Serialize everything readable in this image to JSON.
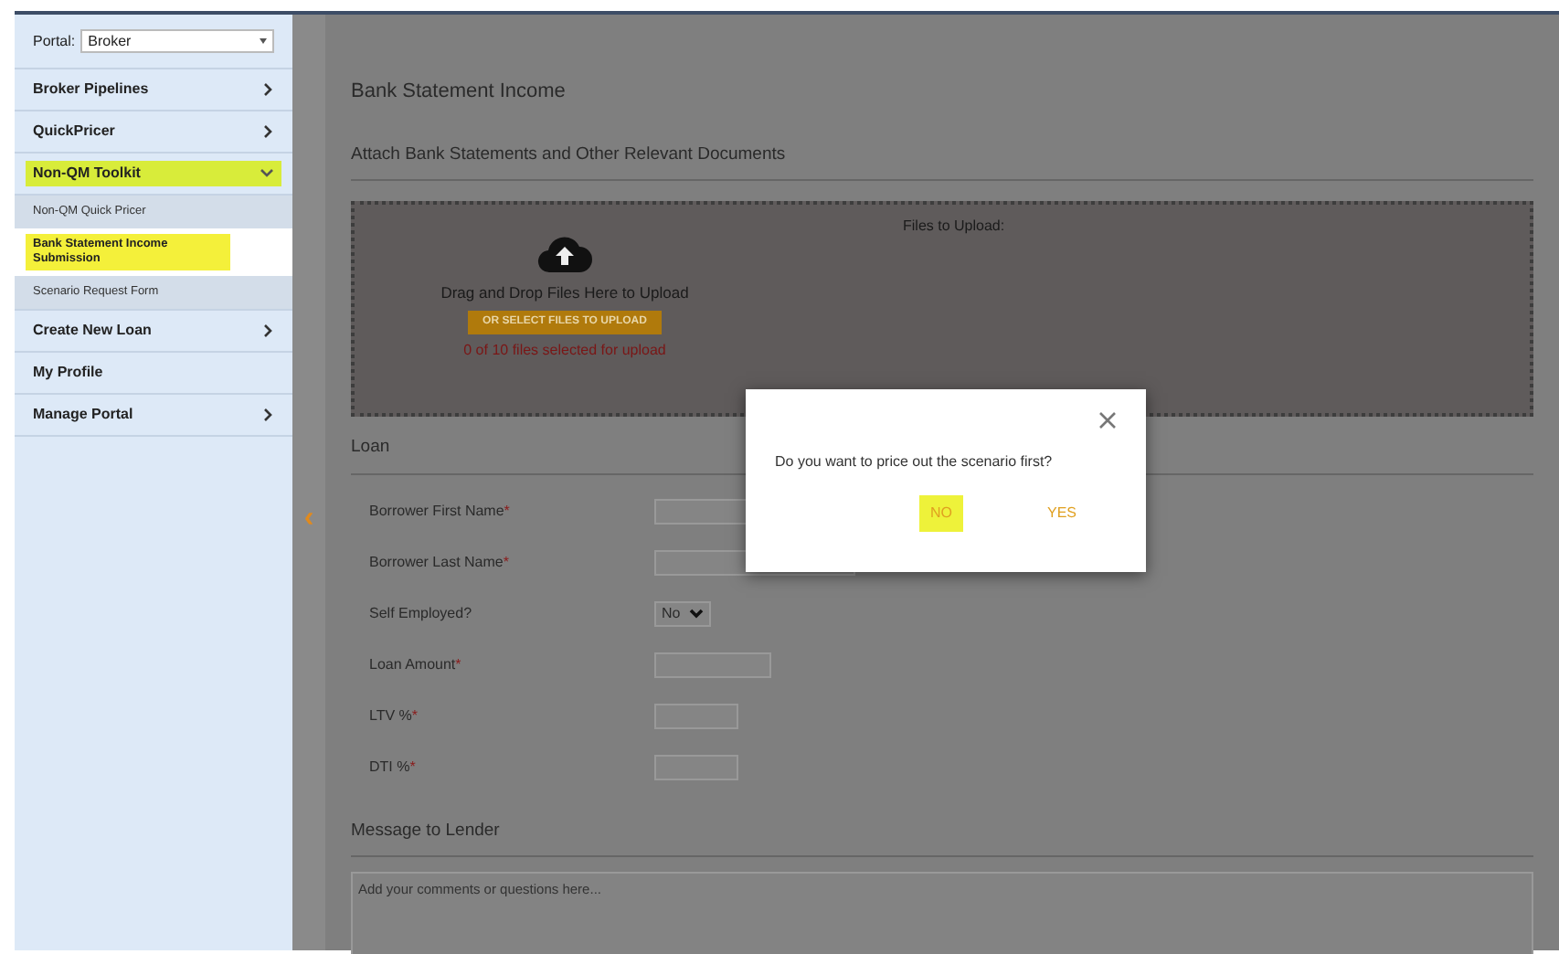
{
  "sidebar": {
    "portal": {
      "label": "Portal:",
      "value": "Broker"
    },
    "items": [
      {
        "label": "Broker Pipelines",
        "kind": "submenu",
        "expanded": false,
        "highlighted": false
      },
      {
        "label": "QuickPricer",
        "kind": "submenu",
        "expanded": false,
        "highlighted": false
      },
      {
        "label": "Non-QM Toolkit",
        "kind": "submenu",
        "expanded": true,
        "highlighted": true,
        "children": [
          {
            "label": "Non-QM Quick Pricer",
            "selected": false,
            "highlighted": false
          },
          {
            "label": "Bank Statement Income Submission",
            "selected": true,
            "highlighted": true
          },
          {
            "label": "Scenario Request Form",
            "selected": false,
            "highlighted": false
          }
        ]
      },
      {
        "label": "Create New Loan",
        "kind": "submenu",
        "expanded": false,
        "highlighted": false
      },
      {
        "label": "My Profile",
        "kind": "link",
        "highlighted": false
      },
      {
        "label": "Manage Portal",
        "kind": "submenu",
        "expanded": false,
        "highlighted": false
      }
    ]
  },
  "collapse_toggle": "‹",
  "main": {
    "title": "Bank Statement Income",
    "attach": {
      "heading": "Attach Bank Statements and Other Relevant Documents",
      "files_label": "Files to Upload:",
      "drop_text": "Drag and Drop Files Here to Upload",
      "button": "OR SELECT FILES TO UPLOAD",
      "count": "0 of 10 files selected for upload"
    },
    "loan": {
      "heading": "Loan",
      "fields": [
        {
          "label": "Borrower First Name",
          "required_mark": "*",
          "kind": "long"
        },
        {
          "label": "Borrower Last Name",
          "required_mark": "*",
          "kind": "long"
        },
        {
          "label": "Self Employed?",
          "kind": "select",
          "value": "No"
        },
        {
          "label": "Loan Amount",
          "required_mark": "*",
          "kind": "medium"
        },
        {
          "label": "LTV %",
          "required_mark": "*",
          "kind": "short"
        },
        {
          "label": "DTI %",
          "required_mark": "*",
          "kind": "short"
        }
      ]
    },
    "message": {
      "heading": "Message to Lender",
      "placeholder": "Add your comments or questions here..."
    }
  },
  "dialog": {
    "message": "Do you want to price out the scenario first?",
    "buttons": [
      {
        "label": "NO",
        "highlighted": true
      },
      {
        "label": "YES",
        "highlighted": false
      }
    ]
  }
}
